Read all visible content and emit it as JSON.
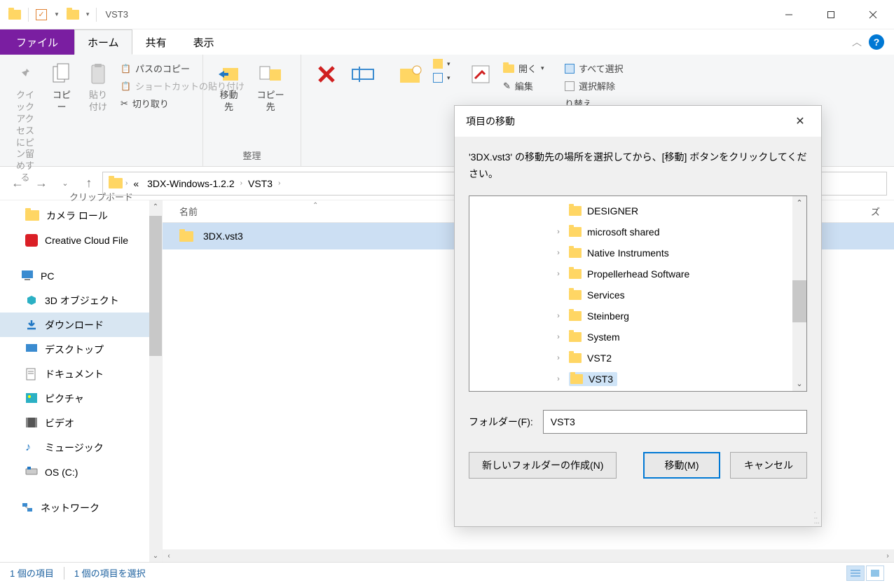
{
  "titlebar": {
    "title": "VST3"
  },
  "tabs": {
    "file": "ファイル",
    "home": "ホーム",
    "share": "共有",
    "view": "表示"
  },
  "ribbon": {
    "pin": "クイック アクセス\nにピン留めする",
    "copy": "コピー",
    "paste": "貼り付け",
    "path_copy": "パスのコピー",
    "paste_shortcut": "ショートカットの貼り付け",
    "cut": "切り取り",
    "clipboard_label": "クリップボード",
    "move_to": "移動先",
    "copy_to": "コピー先",
    "delete": "削除",
    "rename": "名前",
    "organize_label": "整理",
    "new_folder": "新しい",
    "properties": "プロパ",
    "open": "開く",
    "edit": "編集",
    "select_all": "すべて選択",
    "select_none": "選択解除",
    "invert_sel": "り替え"
  },
  "nav": {
    "crumb1": "3DX-Windows-1.2.2",
    "crumb2": "VST3"
  },
  "sidebar": {
    "camera_roll": "カメラ ロール",
    "creative_cloud": "Creative Cloud File",
    "pc": "PC",
    "objects3d": "3D オブジェクト",
    "downloads": "ダウンロード",
    "desktop": "デスクトップ",
    "documents": "ドキュメント",
    "pictures": "ピクチャ",
    "videos": "ビデオ",
    "music": "ミュージック",
    "os_c": "OS (C:)",
    "network": "ネットワーク"
  },
  "content": {
    "col_name": "名前",
    "file1": "3DX.vst3",
    "col_size_hint": "ズ"
  },
  "status": {
    "items": "1 個の項目",
    "selected": "1 個の項目を選択"
  },
  "dialog": {
    "title": "項目の移動",
    "instruction": "'3DX.vst3' の移動先の場所を選択してから、[移動] ボタンをクリックしてください。",
    "tree": [
      {
        "name": "DESIGNER",
        "expand": false
      },
      {
        "name": "microsoft shared",
        "expand": true
      },
      {
        "name": "Native Instruments",
        "expand": true
      },
      {
        "name": "Propellerhead Software",
        "expand": true
      },
      {
        "name": "Services",
        "expand": false
      },
      {
        "name": "Steinberg",
        "expand": true
      },
      {
        "name": "System",
        "expand": true
      },
      {
        "name": "VST2",
        "expand": true
      },
      {
        "name": "VST3",
        "expand": true,
        "selected": true
      }
    ],
    "folder_label": "フォルダー(F):",
    "folder_value": "VST3",
    "btn_new": "新しいフォルダーの作成(N)",
    "btn_move": "移動(M)",
    "btn_cancel": "キャンセル"
  }
}
